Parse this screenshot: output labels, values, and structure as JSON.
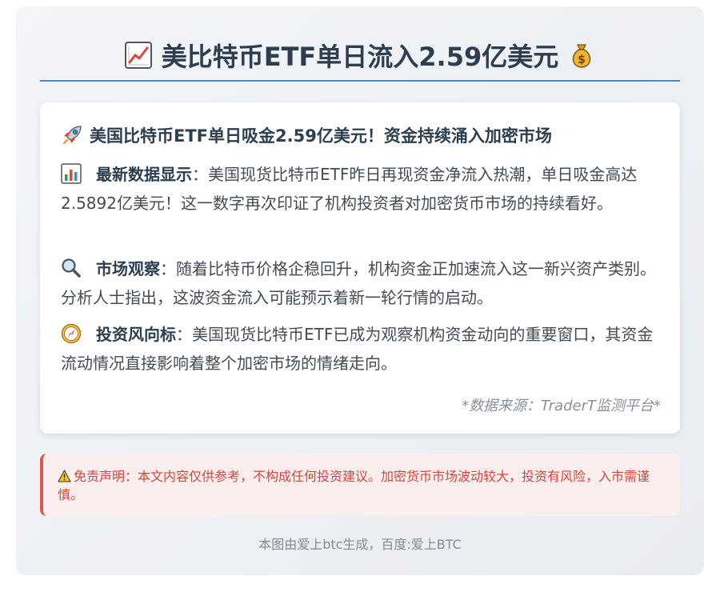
{
  "header": {
    "title": "美比特币ETF单日流入2.59亿美元",
    "leading_icon": "chart-increasing-icon",
    "trailing_icon": "money-bag-icon"
  },
  "card": {
    "heading": "美国比特币ETF单日吸金2.59亿美元！资金持续涌入加密市场",
    "heading_icon": "rocket-icon",
    "paragraphs": [
      {
        "icon": "bar-chart-icon",
        "label": "最新数据显示",
        "text": "：美国现货比特币ETF昨日再现资金净流入热潮，单日吸金高达2.5892亿美元！这一数字再次印证了机构投资者对加密货币市场的持续看好。"
      },
      {
        "icon": "magnifier-icon",
        "label": "市场观察",
        "text": "：随着比特币价格企稳回升，机构资金正加速流入这一新兴资产类别。分析人士指出，这波资金流入可能预示着新一轮行情的启动。"
      },
      {
        "icon": "compass-icon",
        "label": "投资风向标",
        "text": "：美国现货比特币ETF已成为观察机构资金动向的重要窗口，其资金流动情况直接影响着整个加密市场的情绪走向。"
      }
    ],
    "source": "*数据来源：TraderT监测平台*"
  },
  "disclaimer": {
    "icon": "warning-icon",
    "text": "免责声明：本文内容仅供参考，不构成任何投资建议。加密货币市场波动较大，投资有风险，入市需谨慎。"
  },
  "footer": {
    "text": "本图由爱上btc生成，百度:爱上BTC"
  },
  "colors": {
    "accent_rule": "#3d8fd1",
    "disclaimer_red": "#e05548",
    "heading_text": "#2c3e50"
  }
}
